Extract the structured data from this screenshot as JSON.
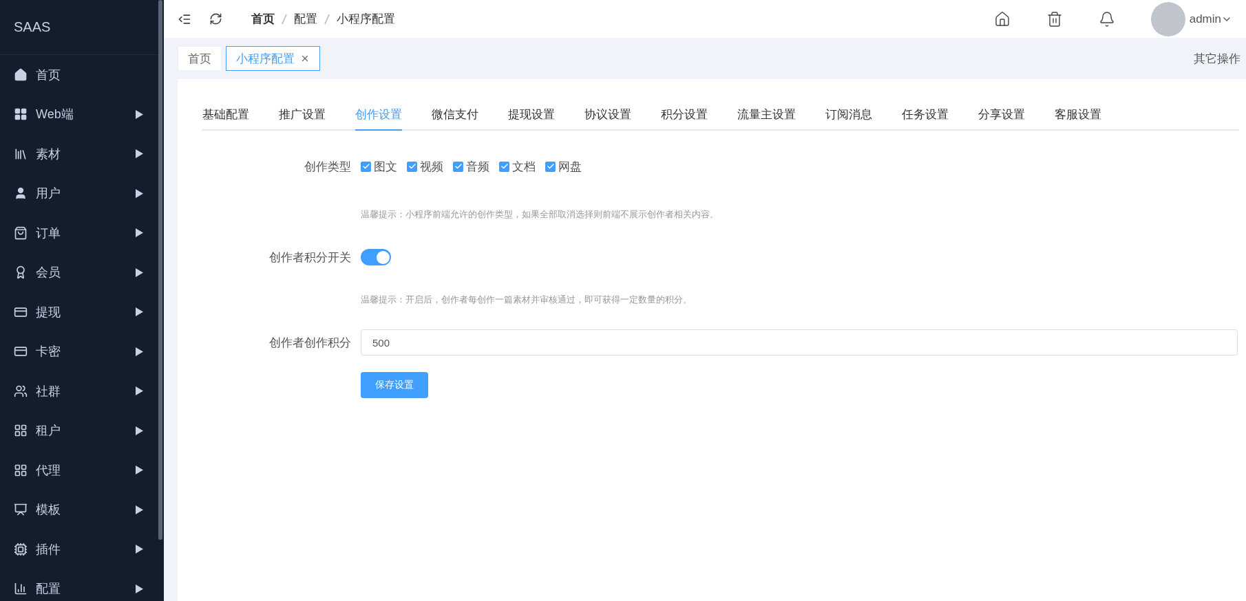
{
  "sidebar": {
    "logo": "SAAS",
    "items": [
      {
        "label": "首页",
        "kind": "link"
      },
      {
        "label": "Web端",
        "kind": "submenu"
      },
      {
        "label": "素材",
        "kind": "submenu"
      },
      {
        "label": "用户",
        "kind": "submenu"
      },
      {
        "label": "订单",
        "kind": "submenu"
      },
      {
        "label": "会员",
        "kind": "submenu"
      },
      {
        "label": "提现",
        "kind": "submenu"
      },
      {
        "label": "卡密",
        "kind": "submenu"
      },
      {
        "label": "社群",
        "kind": "submenu"
      },
      {
        "label": "租户",
        "kind": "submenu"
      },
      {
        "label": "代理",
        "kind": "submenu"
      },
      {
        "label": "模板",
        "kind": "submenu"
      },
      {
        "label": "插件",
        "kind": "submenu"
      },
      {
        "label": "配置",
        "kind": "submenu"
      }
    ]
  },
  "header": {
    "breadcrumb": [
      "首页",
      "配置",
      "小程序配置"
    ],
    "user": "admin"
  },
  "tag_bar": {
    "tags": [
      {
        "label": "首页",
        "selected": false,
        "closable": false
      },
      {
        "label": "小程序配置",
        "selected": true,
        "closable": true
      }
    ],
    "more": "其它操作"
  },
  "tabs": [
    {
      "label": "基础配置",
      "selected": false
    },
    {
      "label": "推广设置",
      "selected": false
    },
    {
      "label": "创作设置",
      "selected": true
    },
    {
      "label": "微信支付",
      "selected": false
    },
    {
      "label": "提现设置",
      "selected": false
    },
    {
      "label": "协议设置",
      "selected": false
    },
    {
      "label": "积分设置",
      "selected": false
    },
    {
      "label": "流量主设置",
      "selected": false
    },
    {
      "label": "订阅消息",
      "selected": false
    },
    {
      "label": "任务设置",
      "selected": false
    },
    {
      "label": "分享设置",
      "selected": false
    },
    {
      "label": "客服设置",
      "selected": false
    }
  ],
  "form": {
    "types_label": "创作类型",
    "types": [
      {
        "label": "图文",
        "checked": true
      },
      {
        "label": "视频",
        "checked": true
      },
      {
        "label": "音频",
        "checked": true
      },
      {
        "label": "文档",
        "checked": true
      },
      {
        "label": "网盘",
        "checked": true
      }
    ],
    "types_hint": "温馨提示：小程序前端允许的创作类型，如果全部取消选择则前端不展示创作者相关内容。",
    "switch_label": "创作者积分开关",
    "switch_on": true,
    "switch_hint": "温馨提示：开启后，创作者每创作一篇素材并审核通过，即可获得一定数量的积分。",
    "points_label": "创作者创作积分",
    "points_value": "500",
    "save": "保存设置"
  }
}
